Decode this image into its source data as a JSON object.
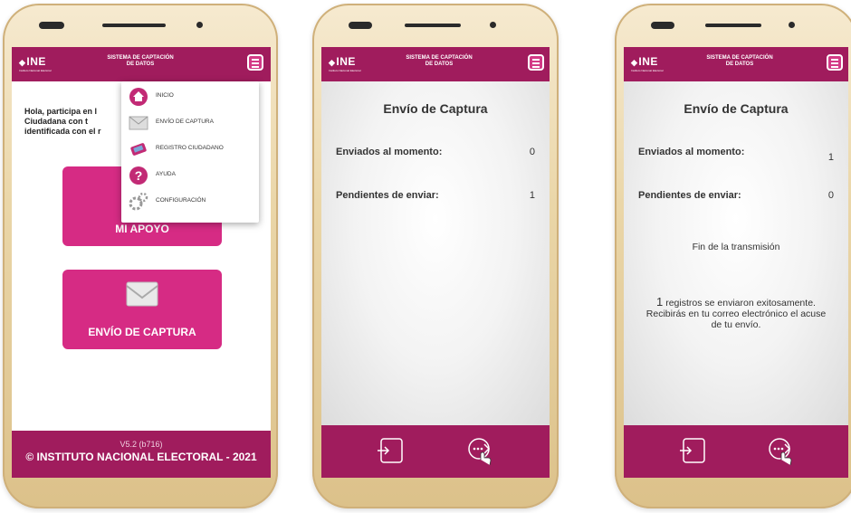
{
  "brand": {
    "logo": "INE",
    "logo_sub": "Instituto Nacional Electoral",
    "system_title_1": "SISTEMA DE CAPTACIÓN",
    "system_title_2": "DE DATOS"
  },
  "phone1": {
    "greeting": "Hola, participa en l... Ciudadana con t... identificada con el r...",
    "greeting_lines": [
      "Hola, participa en l",
      "Ciudadana con t",
      "identificada con el r"
    ],
    "tile1_label": "MI APOYO",
    "tile2_label": "ENVÍO DE CAPTURA",
    "menu": [
      {
        "icon": "home-icon",
        "label": "INICIO"
      },
      {
        "icon": "envelope-icon",
        "label": "ENVÍO DE CAPTURA"
      },
      {
        "icon": "registry-icon",
        "label": "REGISTRO CIUDADANO"
      },
      {
        "icon": "help-icon",
        "label": "AYUDA"
      },
      {
        "icon": "gear-icon",
        "label": "CONFIGURACIÓN"
      }
    ],
    "version": "V5.2 (b716)",
    "copyright": "© INSTITUTO NACIONAL ELECTORAL - 2021"
  },
  "phone2": {
    "title": "Envío de Captura",
    "sent_label": "Enviados al momento:",
    "sent_value": "0",
    "pending_label": "Pendientes de enviar:",
    "pending_value": "1"
  },
  "phone3": {
    "title": "Envío de Captura",
    "sent_label": "Enviados al momento:",
    "sent_value": "1",
    "pending_label": "Pendientes de enviar:",
    "pending_value": "0",
    "end_msg": "Fin de la transmisión",
    "result_count": "1",
    "result_line1": " registros se enviaron exitosamente.",
    "result_line2": "Recibirás en tu correo electrónico el acuse",
    "result_line3": "de tu envío."
  },
  "colors": {
    "primary": "#a01c5d",
    "tile": "#d62b84",
    "phone_gold": "#e8d3a5"
  }
}
